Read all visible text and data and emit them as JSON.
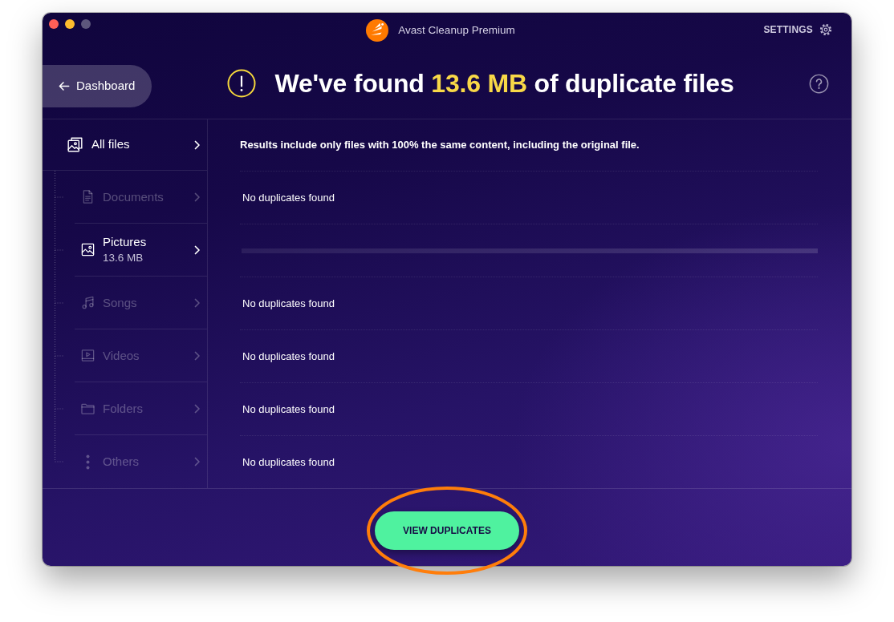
{
  "window": {
    "title": "Avast Cleanup Premium",
    "controls": [
      {
        "kind": "close",
        "disabled": false
      },
      {
        "kind": "minimize",
        "disabled": false
      },
      {
        "kind": "zoom",
        "disabled": true
      }
    ]
  },
  "settings_link": "SETTINGS",
  "back_button": "Dashboard",
  "heading": {
    "before": "We've found",
    "highlight": "13.6 MB",
    "after": "of duplicate files"
  },
  "sidebar": {
    "items": [
      {
        "label": "All files",
        "kind": "all",
        "disabled": false,
        "children": [
          {
            "label": "Documents",
            "kind": "document",
            "disabled": true
          },
          {
            "label": "Pictures",
            "kind": "picture",
            "size": "13.6 MB",
            "disabled": false
          },
          {
            "label": "Songs",
            "kind": "music",
            "disabled": true
          },
          {
            "label": "Videos",
            "kind": "video",
            "disabled": true
          },
          {
            "label": "Folders",
            "kind": "folder",
            "disabled": true
          },
          {
            "label": "Others",
            "kind": "other",
            "disabled": true
          }
        ]
      }
    ]
  },
  "results": {
    "note": "Results include only files with 100% the same content, including the original file.",
    "rows": [
      {
        "kind": "message",
        "text": "No duplicates found"
      },
      {
        "kind": "loading"
      },
      {
        "kind": "message",
        "text": "No duplicates found"
      },
      {
        "kind": "message",
        "text": "No duplicates found"
      },
      {
        "kind": "message",
        "text": "No duplicates found"
      },
      {
        "kind": "message",
        "text": "No duplicates found"
      }
    ]
  },
  "primary_button": "VIEW DUPLICATES"
}
